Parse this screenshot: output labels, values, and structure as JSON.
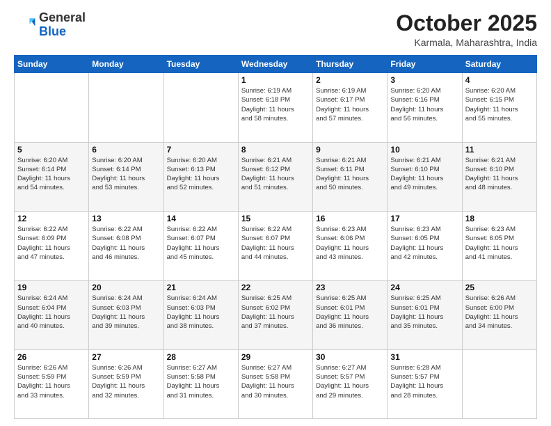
{
  "header": {
    "logo_general": "General",
    "logo_blue": "Blue",
    "month_title": "October 2025",
    "location": "Karmala, Maharashtra, India"
  },
  "days_of_week": [
    "Sunday",
    "Monday",
    "Tuesday",
    "Wednesday",
    "Thursday",
    "Friday",
    "Saturday"
  ],
  "weeks": [
    [
      {
        "day": "",
        "info": ""
      },
      {
        "day": "",
        "info": ""
      },
      {
        "day": "",
        "info": ""
      },
      {
        "day": "1",
        "info": "Sunrise: 6:19 AM\nSunset: 6:18 PM\nDaylight: 11 hours\nand 58 minutes."
      },
      {
        "day": "2",
        "info": "Sunrise: 6:19 AM\nSunset: 6:17 PM\nDaylight: 11 hours\nand 57 minutes."
      },
      {
        "day": "3",
        "info": "Sunrise: 6:20 AM\nSunset: 6:16 PM\nDaylight: 11 hours\nand 56 minutes."
      },
      {
        "day": "4",
        "info": "Sunrise: 6:20 AM\nSunset: 6:15 PM\nDaylight: 11 hours\nand 55 minutes."
      }
    ],
    [
      {
        "day": "5",
        "info": "Sunrise: 6:20 AM\nSunset: 6:14 PM\nDaylight: 11 hours\nand 54 minutes."
      },
      {
        "day": "6",
        "info": "Sunrise: 6:20 AM\nSunset: 6:14 PM\nDaylight: 11 hours\nand 53 minutes."
      },
      {
        "day": "7",
        "info": "Sunrise: 6:20 AM\nSunset: 6:13 PM\nDaylight: 11 hours\nand 52 minutes."
      },
      {
        "day": "8",
        "info": "Sunrise: 6:21 AM\nSunset: 6:12 PM\nDaylight: 11 hours\nand 51 minutes."
      },
      {
        "day": "9",
        "info": "Sunrise: 6:21 AM\nSunset: 6:11 PM\nDaylight: 11 hours\nand 50 minutes."
      },
      {
        "day": "10",
        "info": "Sunrise: 6:21 AM\nSunset: 6:10 PM\nDaylight: 11 hours\nand 49 minutes."
      },
      {
        "day": "11",
        "info": "Sunrise: 6:21 AM\nSunset: 6:10 PM\nDaylight: 11 hours\nand 48 minutes."
      }
    ],
    [
      {
        "day": "12",
        "info": "Sunrise: 6:22 AM\nSunset: 6:09 PM\nDaylight: 11 hours\nand 47 minutes."
      },
      {
        "day": "13",
        "info": "Sunrise: 6:22 AM\nSunset: 6:08 PM\nDaylight: 11 hours\nand 46 minutes."
      },
      {
        "day": "14",
        "info": "Sunrise: 6:22 AM\nSunset: 6:07 PM\nDaylight: 11 hours\nand 45 minutes."
      },
      {
        "day": "15",
        "info": "Sunrise: 6:22 AM\nSunset: 6:07 PM\nDaylight: 11 hours\nand 44 minutes."
      },
      {
        "day": "16",
        "info": "Sunrise: 6:23 AM\nSunset: 6:06 PM\nDaylight: 11 hours\nand 43 minutes."
      },
      {
        "day": "17",
        "info": "Sunrise: 6:23 AM\nSunset: 6:05 PM\nDaylight: 11 hours\nand 42 minutes."
      },
      {
        "day": "18",
        "info": "Sunrise: 6:23 AM\nSunset: 6:05 PM\nDaylight: 11 hours\nand 41 minutes."
      }
    ],
    [
      {
        "day": "19",
        "info": "Sunrise: 6:24 AM\nSunset: 6:04 PM\nDaylight: 11 hours\nand 40 minutes."
      },
      {
        "day": "20",
        "info": "Sunrise: 6:24 AM\nSunset: 6:03 PM\nDaylight: 11 hours\nand 39 minutes."
      },
      {
        "day": "21",
        "info": "Sunrise: 6:24 AM\nSunset: 6:03 PM\nDaylight: 11 hours\nand 38 minutes."
      },
      {
        "day": "22",
        "info": "Sunrise: 6:25 AM\nSunset: 6:02 PM\nDaylight: 11 hours\nand 37 minutes."
      },
      {
        "day": "23",
        "info": "Sunrise: 6:25 AM\nSunset: 6:01 PM\nDaylight: 11 hours\nand 36 minutes."
      },
      {
        "day": "24",
        "info": "Sunrise: 6:25 AM\nSunset: 6:01 PM\nDaylight: 11 hours\nand 35 minutes."
      },
      {
        "day": "25",
        "info": "Sunrise: 6:26 AM\nSunset: 6:00 PM\nDaylight: 11 hours\nand 34 minutes."
      }
    ],
    [
      {
        "day": "26",
        "info": "Sunrise: 6:26 AM\nSunset: 5:59 PM\nDaylight: 11 hours\nand 33 minutes."
      },
      {
        "day": "27",
        "info": "Sunrise: 6:26 AM\nSunset: 5:59 PM\nDaylight: 11 hours\nand 32 minutes."
      },
      {
        "day": "28",
        "info": "Sunrise: 6:27 AM\nSunset: 5:58 PM\nDaylight: 11 hours\nand 31 minutes."
      },
      {
        "day": "29",
        "info": "Sunrise: 6:27 AM\nSunset: 5:58 PM\nDaylight: 11 hours\nand 30 minutes."
      },
      {
        "day": "30",
        "info": "Sunrise: 6:27 AM\nSunset: 5:57 PM\nDaylight: 11 hours\nand 29 minutes."
      },
      {
        "day": "31",
        "info": "Sunrise: 6:28 AM\nSunset: 5:57 PM\nDaylight: 11 hours\nand 28 minutes."
      },
      {
        "day": "",
        "info": ""
      }
    ]
  ]
}
